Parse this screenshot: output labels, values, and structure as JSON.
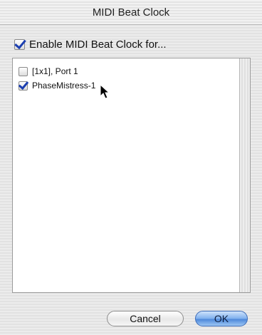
{
  "window": {
    "title": "MIDI Beat Clock"
  },
  "enable": {
    "label": "Enable MIDI Beat Clock for...",
    "checked": true
  },
  "devices": [
    {
      "label": "[1x1], Port 1",
      "checked": false
    },
    {
      "label": "PhaseMistress-1",
      "checked": true
    }
  ],
  "buttons": {
    "cancel": "Cancel",
    "ok": "OK"
  }
}
